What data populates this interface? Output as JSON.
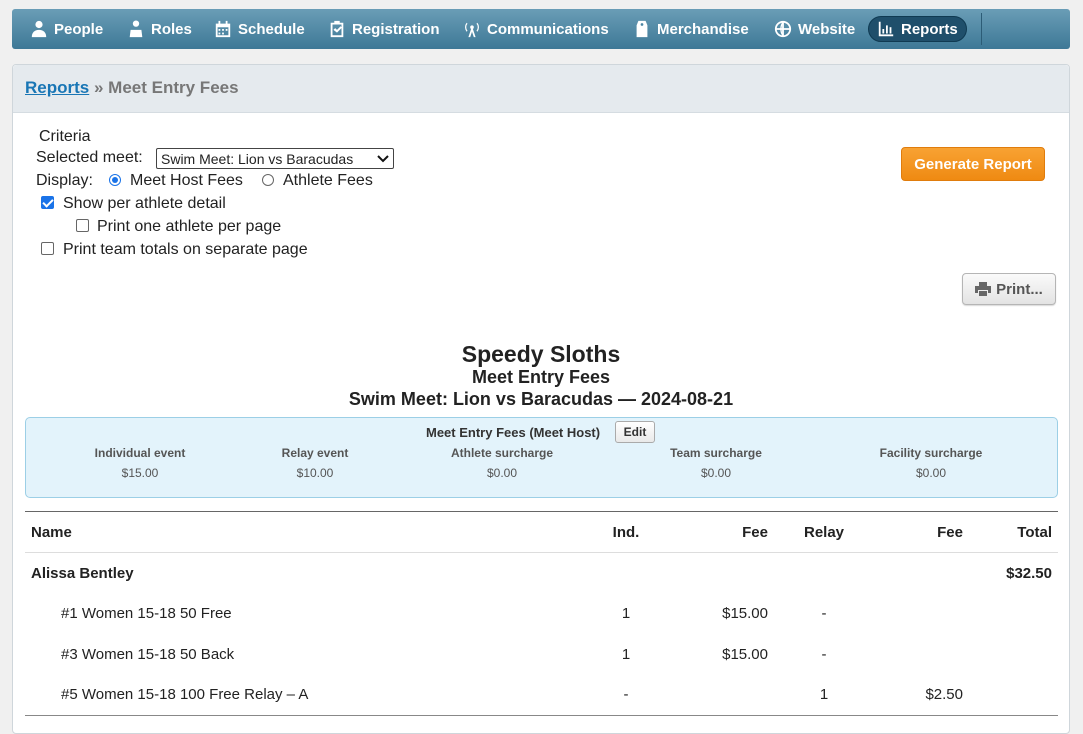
{
  "nav": {
    "items": [
      {
        "label": "People",
        "icon": "people-icon"
      },
      {
        "label": "Roles",
        "icon": "roles-icon"
      },
      {
        "label": "Schedule",
        "icon": "calendar-icon"
      },
      {
        "label": "Registration",
        "icon": "clipboard-check-icon"
      },
      {
        "label": "Communications",
        "icon": "broadcast-icon"
      },
      {
        "label": "Merchandise",
        "icon": "price-tag-icon"
      },
      {
        "label": "Website",
        "icon": "globe-icon"
      },
      {
        "label": "Reports",
        "icon": "bar-chart-icon",
        "active": true
      }
    ]
  },
  "breadcrumb": {
    "link": "Reports",
    "separator": "»",
    "current": "Meet Entry Fees"
  },
  "criteria": {
    "heading": "Criteria",
    "selected_meet_label": "Selected meet:",
    "selected_meet_value": "Swim Meet: Lion vs Baracudas",
    "display_label": "Display:",
    "display_options": [
      "Meet Host Fees",
      "Athlete Fees"
    ],
    "display_selected": "Meet Host Fees",
    "show_detail_label": "Show per athlete detail",
    "show_detail_checked": true,
    "one_per_page_label": "Print one athlete per page",
    "one_per_page_checked": false,
    "team_totals_label": "Print team totals on separate page",
    "team_totals_checked": false
  },
  "buttons": {
    "generate": "Generate Report",
    "print": "Print..."
  },
  "report": {
    "team": "Speedy Sloths",
    "title": "Meet Entry Fees",
    "meet": "Swim Meet: Lion vs Baracudas — 2024-08-21"
  },
  "fees": {
    "title": "Meet Entry Fees (Meet Host)",
    "edit_label": "Edit",
    "items": [
      {
        "label": "Individual event",
        "value": "$15.00"
      },
      {
        "label": "Relay event",
        "value": "$10.00"
      },
      {
        "label": "Athlete surcharge",
        "value": "$0.00"
      },
      {
        "label": "Team surcharge",
        "value": "$0.00"
      },
      {
        "label": "Facility surcharge",
        "value": "$0.00"
      }
    ]
  },
  "table": {
    "headers": [
      "Name",
      "Ind.",
      "Fee",
      "Relay",
      "Fee",
      "Total"
    ],
    "athlete": {
      "name": "Alissa Bentley",
      "total": "$32.50"
    },
    "rows": [
      {
        "event": "#1 Women 15-18 50 Free",
        "ind": "1",
        "fee": "$15.00",
        "relay": "-",
        "relay_fee": ""
      },
      {
        "event": "#3 Women 15-18 50 Back",
        "ind": "1",
        "fee": "$15.00",
        "relay": "-",
        "relay_fee": ""
      },
      {
        "event": "#5 Women 15-18 100 Free Relay – A",
        "ind": "-",
        "fee": "",
        "relay": "1",
        "relay_fee": "$2.50"
      }
    ]
  }
}
